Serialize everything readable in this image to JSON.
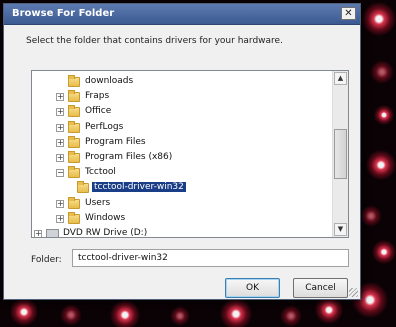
{
  "dialog": {
    "title": "Browse For Folder",
    "close_glyph": "✕",
    "instruction": "Select the folder that contains drivers for your hardware."
  },
  "tree": {
    "items": [
      {
        "label": "downloads",
        "icon": "folder-icon",
        "expander": "",
        "depth": 1
      },
      {
        "label": "Fraps",
        "icon": "folder-icon",
        "expander": "+",
        "depth": 1
      },
      {
        "label": "Office",
        "icon": "folder-icon",
        "expander": "+",
        "depth": 1
      },
      {
        "label": "PerfLogs",
        "icon": "folder-icon",
        "expander": "+",
        "depth": 1
      },
      {
        "label": "Program Files",
        "icon": "folder-icon",
        "expander": "+",
        "depth": 1
      },
      {
        "label": "Program Files (x86)",
        "icon": "folder-icon",
        "expander": "+",
        "depth": 1
      },
      {
        "label": "Tcctool",
        "icon": "folder-icon",
        "expander": "−",
        "depth": 1
      },
      {
        "label": "tcctool-driver-win32",
        "icon": "folder-icon",
        "expander": "",
        "depth": 2,
        "selected": true
      },
      {
        "label": "Users",
        "icon": "folder-icon",
        "expander": "+",
        "depth": 1
      },
      {
        "label": "Windows",
        "icon": "folder-icon",
        "expander": "+",
        "depth": 1
      },
      {
        "label": "DVD RW Drive (D:)",
        "icon": "dvd-drive-icon",
        "expander": "+",
        "depth": 0
      }
    ]
  },
  "folder": {
    "label": "Folder:",
    "value": "tcctool-driver-win32"
  },
  "buttons": {
    "ok": "OK",
    "cancel": "Cancel"
  },
  "scrollbar": {
    "up_glyph": "▲",
    "down_glyph": "▼"
  }
}
